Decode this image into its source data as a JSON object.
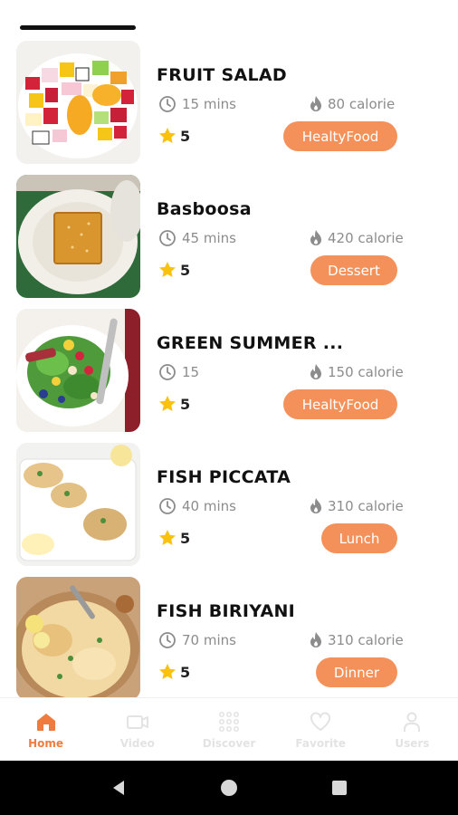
{
  "recipes": [
    {
      "title": "FRUIT SALAD",
      "time": "15 mins",
      "calories": "80 calorie",
      "rating": "5",
      "tag": "HealtyFood"
    },
    {
      "title": "Basboosa",
      "time": "45 mins",
      "calories": "420 calorie",
      "rating": "5",
      "tag": "Dessert"
    },
    {
      "title": "GREEN SUMMER ...",
      "time": "15",
      "calories": "150 calorie",
      "rating": "5",
      "tag": "HealtyFood"
    },
    {
      "title": "FISH PICCATA",
      "time": "40 mins",
      "calories": "310 calorie",
      "rating": "5",
      "tag": "Lunch"
    },
    {
      "title": "FISH BIRIYANI",
      "time": "70 mins",
      "calories": "310 calorie",
      "rating": "5",
      "tag": "Dinner"
    }
  ],
  "bottom_nav": [
    {
      "label": "Home",
      "icon": "home-icon",
      "active": true
    },
    {
      "label": "Video",
      "icon": "video-icon",
      "active": false
    },
    {
      "label": "Discover",
      "icon": "discover-grid-icon",
      "active": false
    },
    {
      "label": "Favorite",
      "icon": "heart-icon",
      "active": false
    },
    {
      "label": "Users",
      "icon": "user-icon",
      "active": false
    }
  ],
  "colors": {
    "accent": "#f4915a",
    "active_nav": "#f07b3f",
    "inactive_nav": "#e3e3e3",
    "muted_text": "#8c8c8c",
    "star": "#f9c20e"
  }
}
